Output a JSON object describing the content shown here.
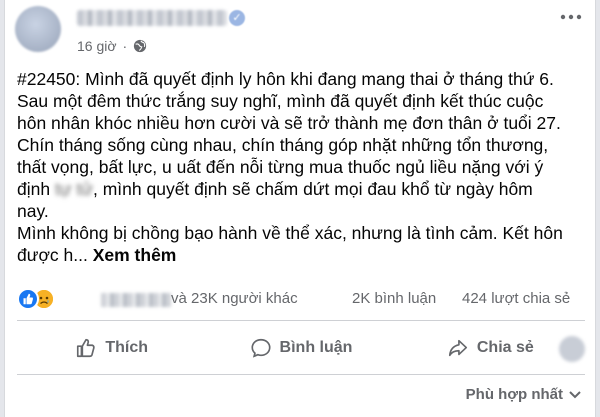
{
  "post": {
    "time": "16 giờ",
    "separator": "·",
    "privacy_icon": "globe-icon",
    "lines": [
      "#22450: Mình đã quyết định ly hôn khi đang mang thai ở tháng thứ 6.",
      "Sau một đêm thức trắng suy nghĩ, mình đã quyết định kết thúc cuộc",
      "hôn nhân khóc nhiều hơn cười và sẽ trở thành mẹ đơn thân ở tuổi 27.",
      "Chín tháng sống cùng nhau, chín tháng góp nhặt những tổn thương,",
      "thất vọng, bất lực, u uất đến nỗi từng mua thuốc ngủ liều nặng với ý"
    ],
    "line6_before": "định ",
    "line6_blurred": "tự tử",
    "line6_after": ", mình quyết định sẽ chấm dứt mọi đau khổ từ ngày hôm",
    "line7": "nay.",
    "line8": "Mình không bị chồng bạo hành về thể xác, nhưng là tình cảm. Kết hôn",
    "line9": "được h...",
    "see_more": "Xem thêm"
  },
  "reactions": {
    "types": [
      "like-reaction-icon",
      "sad-reaction-icon"
    ],
    "summary": "và 23K người khác",
    "comments": "2K bình luận",
    "shares": "424 lượt chia sẻ"
  },
  "actions": {
    "like": "Thích",
    "comment": "Bình luận",
    "share": "Chia sẻ"
  },
  "sort": {
    "label": "Phù hợp nhất"
  },
  "colors": {
    "like_blue": "#1877f2",
    "sad_yellow": "#f7b125",
    "secondary_text": "#65676b"
  }
}
